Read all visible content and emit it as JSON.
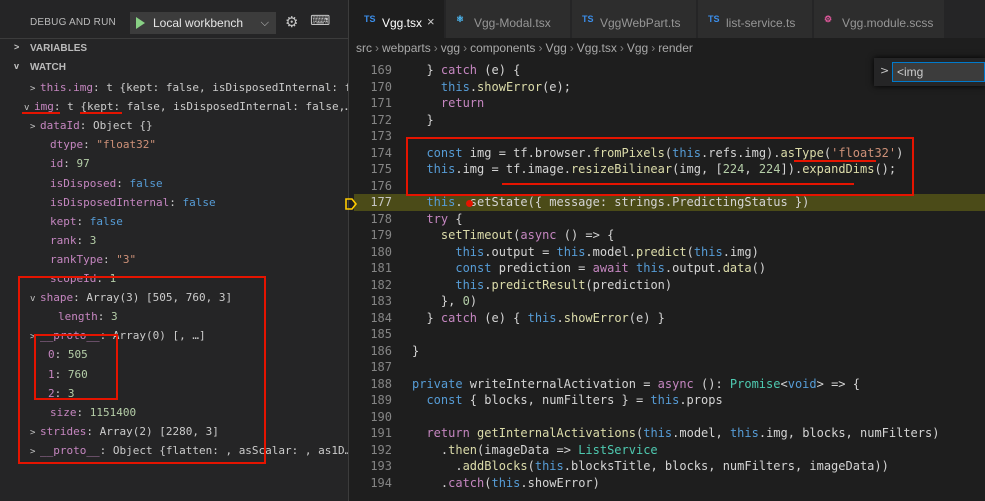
{
  "debug": {
    "title": "DEBUG AND RUN",
    "launch_config": "Local workbench",
    "variables_label": "VARIABLES",
    "watch_label": "WATCH",
    "watch_rows": [
      {
        "caret": ">",
        "name": "this.img",
        "sep": ": ",
        "value": "t {kept: false, isDisposedInternal: f…"
      },
      {
        "caret": "v",
        "name": "img",
        "sep": ": ",
        "value": "t {kept: false, isDisposedInternal: false,…"
      },
      {
        "caret": ">",
        "name": "dataId",
        "sep": ": ",
        "value": "Object {}"
      },
      {
        "caret": "",
        "name": "dtype",
        "sep": ": ",
        "value": "\"float32\""
      },
      {
        "caret": "",
        "name": "id",
        "sep": ": ",
        "value": "97"
      },
      {
        "caret": "",
        "name": "isDisposed",
        "sep": ": ",
        "value": "false"
      },
      {
        "caret": "",
        "name": "isDisposedInternal",
        "sep": ": ",
        "value": "false"
      },
      {
        "caret": "",
        "name": "kept",
        "sep": ": ",
        "value": "false"
      },
      {
        "caret": "",
        "name": "rank",
        "sep": ": ",
        "value": "3"
      },
      {
        "caret": "",
        "name": "rankType",
        "sep": ": ",
        "value": "\"3\""
      },
      {
        "caret": "",
        "name": "scopeId",
        "sep": ": ",
        "value": "1"
      },
      {
        "caret": "v",
        "name": "shape",
        "sep": ": ",
        "value": "Array(3) [505, 760, 3]"
      },
      {
        "caret": "",
        "name": "length",
        "sep": ": ",
        "value": "3"
      },
      {
        "caret": ">",
        "name": "__proto__",
        "sep": ": ",
        "value": "Array(0) [, …]"
      },
      {
        "caret": "",
        "name": "0",
        "sep": ": ",
        "value": "505"
      },
      {
        "caret": "",
        "name": "1",
        "sep": ": ",
        "value": "760"
      },
      {
        "caret": "",
        "name": "2",
        "sep": ": ",
        "value": "3"
      },
      {
        "caret": "",
        "name": "size",
        "sep": ": ",
        "value": "1151400"
      },
      {
        "caret": ">",
        "name": "strides",
        "sep": ": ",
        "value": "Array(2) [2280, 3]"
      },
      {
        "caret": ">",
        "name": "__proto__",
        "sep": ": ",
        "value": "Object {flatten: , asScalar: , as1D…"
      }
    ]
  },
  "tabs": [
    {
      "icon": "TS",
      "label": "Vgg.tsx",
      "active": true
    },
    {
      "icon": "⚛",
      "label": "Vgg-Modal.tsx",
      "active": false
    },
    {
      "icon": "TS",
      "label": "VggWebPart.ts",
      "active": false
    },
    {
      "icon": "TS",
      "label": "list-service.ts",
      "active": false
    },
    {
      "icon": "⚙",
      "label": "Vgg.module.scss",
      "active": false
    }
  ],
  "breadcrumb": [
    "src",
    "webparts",
    "vgg",
    "components",
    "Vgg",
    "Vgg.tsx",
    "Vgg",
    "render"
  ],
  "find_widget": {
    "value": "<img"
  },
  "editor": {
    "current_line": "177",
    "lines": [
      {
        "n": "169",
        "code": "  } catch (e) {"
      },
      {
        "n": "170",
        "code": "    this.showError(e);"
      },
      {
        "n": "171",
        "code": "    return"
      },
      {
        "n": "172",
        "code": "  }"
      },
      {
        "n": "173",
        "code": ""
      },
      {
        "n": "174",
        "code": "  const img = tf.browser.fromPixels(this.refs.img).asType('float32')"
      },
      {
        "n": "175",
        "code": "  this.img = tf.image.resizeBilinear(img, [224, 224]).expandDims();"
      },
      {
        "n": "176",
        "code": ""
      },
      {
        "n": "177",
        "code": "  this. setState({ message: strings.PredictingStatus })"
      },
      {
        "n": "178",
        "code": "  try {"
      },
      {
        "n": "179",
        "code": "    setTimeout(async () => {"
      },
      {
        "n": "180",
        "code": "      this.output = this.model.predict(this.img)"
      },
      {
        "n": "181",
        "code": "      const prediction = await this.output.data()"
      },
      {
        "n": "182",
        "code": "      this.predictResult(prediction)"
      },
      {
        "n": "183",
        "code": "    }, 0)"
      },
      {
        "n": "184",
        "code": "  } catch (e) { this.showError(e) }"
      },
      {
        "n": "185",
        "code": ""
      },
      {
        "n": "186",
        "code": "}"
      },
      {
        "n": "187",
        "code": ""
      },
      {
        "n": "188",
        "code": "private writeInternalActivation = async (): Promise<void> => {"
      },
      {
        "n": "189",
        "code": "  const { blocks, numFilters } = this.props"
      },
      {
        "n": "190",
        "code": ""
      },
      {
        "n": "191",
        "code": "  return getInternalActivations(this.model, this.img, blocks, numFilters)"
      },
      {
        "n": "192",
        "code": "    .then(imageData => ListService"
      },
      {
        "n": "193",
        "code": "      .addBlocks(this.blocksTitle, blocks, numFilters, imageData))"
      },
      {
        "n": "194",
        "code": "    .catch(this.showError)"
      }
    ]
  }
}
